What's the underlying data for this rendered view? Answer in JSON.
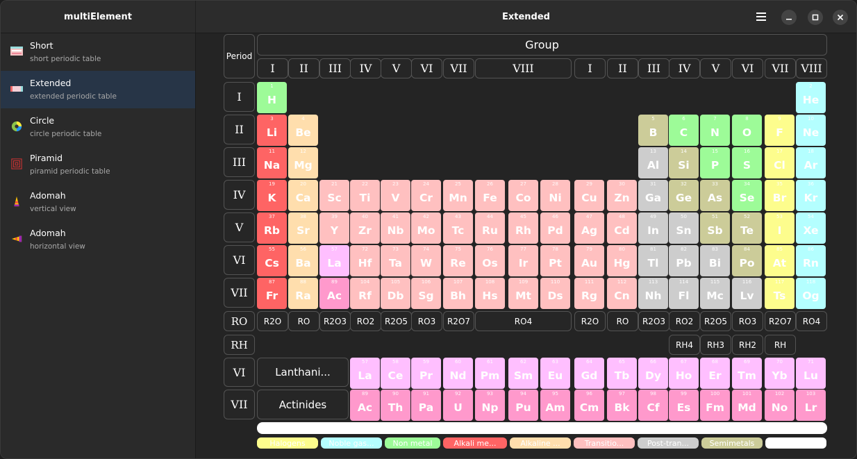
{
  "app": {
    "sidebar_title": "multiElement",
    "window_title": "Extended"
  },
  "sidebar": {
    "items": [
      {
        "title": "Short",
        "subtitle": "short periodic table",
        "icon": "short-table-icon"
      },
      {
        "title": "Extended",
        "subtitle": "extended periodic table",
        "icon": "extended-table-icon",
        "active": true
      },
      {
        "title": "Circle",
        "subtitle": "circle periodic table",
        "icon": "circle-table-icon"
      },
      {
        "title": "Piramid",
        "subtitle": "piramid periodic table",
        "icon": "piramid-table-icon"
      },
      {
        "title": "Adomah",
        "subtitle": "vertical view",
        "icon": "adomah-vertical-icon"
      },
      {
        "title": "Adomah",
        "subtitle": "horizontal view",
        "icon": "adomah-horizontal-icon"
      }
    ]
  },
  "table": {
    "period_label": "Period",
    "group_label": "Group",
    "group_numerals": [
      "I",
      "II",
      "III",
      "IV",
      "V",
      "VI",
      "VII",
      "VIII",
      "I",
      "II",
      "III",
      "IV",
      "V",
      "VI",
      "VII",
      "VIII"
    ],
    "period_numerals": [
      "I",
      "II",
      "III",
      "IV",
      "V",
      "VI",
      "VII"
    ],
    "ro_label": "RO",
    "rh_label": "RH",
    "oxides": [
      "R2O",
      "RO",
      "R2O3",
      "RO2",
      "R2O5",
      "RO3",
      "R2O7",
      "RO4",
      "R2O",
      "RO",
      "R2O3",
      "RO2",
      "R2O5",
      "RO3",
      "R2O7",
      "RO4"
    ],
    "hydrides": [
      "RH4",
      "RH3",
      "RH2",
      "RH"
    ],
    "f_period_numerals": [
      "VI",
      "VII"
    ],
    "lanthanides_label": "Lanthani...",
    "actinides_label": "Actinides",
    "elements": [
      {
        "n": "1",
        "s": "H",
        "cat": "nonmetal"
      },
      {
        "n": "2",
        "s": "He",
        "cat": "noble"
      },
      {
        "n": "3",
        "s": "Li",
        "cat": "alkali"
      },
      {
        "n": "4",
        "s": "Be",
        "cat": "alkaline"
      },
      {
        "n": "5",
        "s": "B",
        "cat": "semimetal"
      },
      {
        "n": "6",
        "s": "C",
        "cat": "nonmetal"
      },
      {
        "n": "7",
        "s": "N",
        "cat": "nonmetal"
      },
      {
        "n": "8",
        "s": "O",
        "cat": "nonmetal"
      },
      {
        "n": "9",
        "s": "F",
        "cat": "halogen"
      },
      {
        "n": "10",
        "s": "Ne",
        "cat": "noble"
      },
      {
        "n": "11",
        "s": "Na",
        "cat": "alkali"
      },
      {
        "n": "12",
        "s": "Mg",
        "cat": "alkaline"
      },
      {
        "n": "13",
        "s": "Al",
        "cat": "posttrans"
      },
      {
        "n": "14",
        "s": "Si",
        "cat": "semimetal"
      },
      {
        "n": "15",
        "s": "P",
        "cat": "nonmetal"
      },
      {
        "n": "16",
        "s": "S",
        "cat": "nonmetal"
      },
      {
        "n": "17",
        "s": "Cl",
        "cat": "halogen"
      },
      {
        "n": "18",
        "s": "Ar",
        "cat": "noble"
      },
      {
        "n": "19",
        "s": "K",
        "cat": "alkali"
      },
      {
        "n": "20",
        "s": "Ca",
        "cat": "alkaline"
      },
      {
        "n": "21",
        "s": "Sc",
        "cat": "transition"
      },
      {
        "n": "22",
        "s": "Ti",
        "cat": "transition"
      },
      {
        "n": "23",
        "s": "V",
        "cat": "transition"
      },
      {
        "n": "24",
        "s": "Cr",
        "cat": "transition"
      },
      {
        "n": "25",
        "s": "Mn",
        "cat": "transition"
      },
      {
        "n": "26",
        "s": "Fe",
        "cat": "transition"
      },
      {
        "n": "27",
        "s": "Co",
        "cat": "transition"
      },
      {
        "n": "28",
        "s": "Ni",
        "cat": "transition"
      },
      {
        "n": "29",
        "s": "Cu",
        "cat": "transition"
      },
      {
        "n": "30",
        "s": "Zn",
        "cat": "transition"
      },
      {
        "n": "31",
        "s": "Ga",
        "cat": "posttrans"
      },
      {
        "n": "32",
        "s": "Ge",
        "cat": "semimetal"
      },
      {
        "n": "33",
        "s": "As",
        "cat": "semimetal"
      },
      {
        "n": "34",
        "s": "Se",
        "cat": "nonmetal"
      },
      {
        "n": "35",
        "s": "Br",
        "cat": "halogen"
      },
      {
        "n": "36",
        "s": "Kr",
        "cat": "noble"
      },
      {
        "n": "37",
        "s": "Rb",
        "cat": "alkali"
      },
      {
        "n": "38",
        "s": "Sr",
        "cat": "alkaline"
      },
      {
        "n": "39",
        "s": "Y",
        "cat": "transition"
      },
      {
        "n": "40",
        "s": "Zr",
        "cat": "transition"
      },
      {
        "n": "41",
        "s": "Nb",
        "cat": "transition"
      },
      {
        "n": "42",
        "s": "Mo",
        "cat": "transition"
      },
      {
        "n": "43",
        "s": "Tc",
        "cat": "transition"
      },
      {
        "n": "44",
        "s": "Ru",
        "cat": "transition"
      },
      {
        "n": "45",
        "s": "Rh",
        "cat": "transition"
      },
      {
        "n": "46",
        "s": "Pd",
        "cat": "transition"
      },
      {
        "n": "47",
        "s": "Ag",
        "cat": "transition"
      },
      {
        "n": "48",
        "s": "Cd",
        "cat": "transition"
      },
      {
        "n": "49",
        "s": "In",
        "cat": "posttrans"
      },
      {
        "n": "50",
        "s": "Sn",
        "cat": "posttrans"
      },
      {
        "n": "51",
        "s": "Sb",
        "cat": "semimetal"
      },
      {
        "n": "52",
        "s": "Te",
        "cat": "semimetal"
      },
      {
        "n": "53",
        "s": "I",
        "cat": "halogen"
      },
      {
        "n": "54",
        "s": "Xe",
        "cat": "noble"
      },
      {
        "n": "55",
        "s": "Cs",
        "cat": "alkali"
      },
      {
        "n": "56",
        "s": "Ba",
        "cat": "alkaline"
      },
      {
        "n": "57",
        "s": "La",
        "cat": "lanthanide"
      },
      {
        "n": "72",
        "s": "Hf",
        "cat": "transition"
      },
      {
        "n": "73",
        "s": "Ta",
        "cat": "transition"
      },
      {
        "n": "74",
        "s": "W",
        "cat": "transition"
      },
      {
        "n": "75",
        "s": "Re",
        "cat": "transition"
      },
      {
        "n": "76",
        "s": "Os",
        "cat": "transition"
      },
      {
        "n": "77",
        "s": "Ir",
        "cat": "transition"
      },
      {
        "n": "78",
        "s": "Pt",
        "cat": "transition"
      },
      {
        "n": "79",
        "s": "Au",
        "cat": "transition"
      },
      {
        "n": "80",
        "s": "Hg",
        "cat": "transition"
      },
      {
        "n": "81",
        "s": "Tl",
        "cat": "posttrans"
      },
      {
        "n": "82",
        "s": "Pb",
        "cat": "posttrans"
      },
      {
        "n": "83",
        "s": "Bi",
        "cat": "posttrans"
      },
      {
        "n": "84",
        "s": "Po",
        "cat": "semimetal"
      },
      {
        "n": "85",
        "s": "At",
        "cat": "halogen"
      },
      {
        "n": "86",
        "s": "Rn",
        "cat": "noble"
      },
      {
        "n": "87",
        "s": "Fr",
        "cat": "alkali"
      },
      {
        "n": "88",
        "s": "Ra",
        "cat": "alkaline"
      },
      {
        "n": "89",
        "s": "Ac",
        "cat": "actinide"
      },
      {
        "n": "104",
        "s": "Rf",
        "cat": "transition"
      },
      {
        "n": "105",
        "s": "Db",
        "cat": "transition"
      },
      {
        "n": "106",
        "s": "Sg",
        "cat": "transition"
      },
      {
        "n": "107",
        "s": "Bh",
        "cat": "transition"
      },
      {
        "n": "108",
        "s": "Hs",
        "cat": "transition"
      },
      {
        "n": "109",
        "s": "Mt",
        "cat": "transition"
      },
      {
        "n": "110",
        "s": "Ds",
        "cat": "transition"
      },
      {
        "n": "111",
        "s": "Rg",
        "cat": "transition"
      },
      {
        "n": "112",
        "s": "Cn",
        "cat": "transition"
      },
      {
        "n": "113",
        "s": "Nh",
        "cat": "posttrans"
      },
      {
        "n": "114",
        "s": "Fl",
        "cat": "posttrans"
      },
      {
        "n": "115",
        "s": "Mc",
        "cat": "posttrans"
      },
      {
        "n": "116",
        "s": "Lv",
        "cat": "posttrans"
      },
      {
        "n": "117",
        "s": "Ts",
        "cat": "halogen"
      },
      {
        "n": "118",
        "s": "Og",
        "cat": "noble"
      }
    ],
    "lanthanides": [
      {
        "n": "57",
        "s": "La"
      },
      {
        "n": "58",
        "s": "Ce"
      },
      {
        "n": "59",
        "s": "Pr"
      },
      {
        "n": "60",
        "s": "Nd"
      },
      {
        "n": "61",
        "s": "Pm"
      },
      {
        "n": "62",
        "s": "Sm"
      },
      {
        "n": "63",
        "s": "Eu"
      },
      {
        "n": "64",
        "s": "Gd"
      },
      {
        "n": "65",
        "s": "Tb"
      },
      {
        "n": "66",
        "s": "Dy"
      },
      {
        "n": "67",
        "s": "Ho"
      },
      {
        "n": "68",
        "s": "Er"
      },
      {
        "n": "69",
        "s": "Tm"
      },
      {
        "n": "70",
        "s": "Yb"
      },
      {
        "n": "71",
        "s": "Lu"
      }
    ],
    "actinides": [
      {
        "n": "89",
        "s": "Ac"
      },
      {
        "n": "90",
        "s": "Th"
      },
      {
        "n": "91",
        "s": "Pa"
      },
      {
        "n": "92",
        "s": "U"
      },
      {
        "n": "93",
        "s": "Np"
      },
      {
        "n": "94",
        "s": "Pu"
      },
      {
        "n": "95",
        "s": "Am"
      },
      {
        "n": "96",
        "s": "Cm"
      },
      {
        "n": "97",
        "s": "Bk"
      },
      {
        "n": "98",
        "s": "Cf"
      },
      {
        "n": "99",
        "s": "Es"
      },
      {
        "n": "100",
        "s": "Fm"
      },
      {
        "n": "101",
        "s": "Md"
      },
      {
        "n": "102",
        "s": "No"
      },
      {
        "n": "103",
        "s": "Lr"
      }
    ]
  },
  "legend": [
    {
      "label": "Halogens",
      "cat": "halogen"
    },
    {
      "label": "Noble gas...",
      "cat": "noble"
    },
    {
      "label": "Non metal",
      "cat": "nonmetal"
    },
    {
      "label": "Alkali me...",
      "cat": "alkali"
    },
    {
      "label": "Alkaline ...",
      "cat": "alkaline"
    },
    {
      "label": "Transitio...",
      "cat": "transition"
    },
    {
      "label": "Post-tran...",
      "cat": "posttrans"
    },
    {
      "label": "Semimetals",
      "cat": "semimetal"
    },
    {
      "label": "",
      "cat": "blank"
    }
  ],
  "colors": {
    "halogen": "#fdfd8d",
    "noble": "#b4ffff",
    "nonmetal": "#9dfb98",
    "alkali": "#fe6464",
    "alkaline": "#ffdead",
    "transition": "#ffc0c0",
    "posttrans": "#cdcdcd",
    "semimetal": "#cccc99",
    "lanthanide": "#ffbfff",
    "actinide": "#ff99cc",
    "blank": "#ffffff",
    "accent_active": "#273547"
  }
}
